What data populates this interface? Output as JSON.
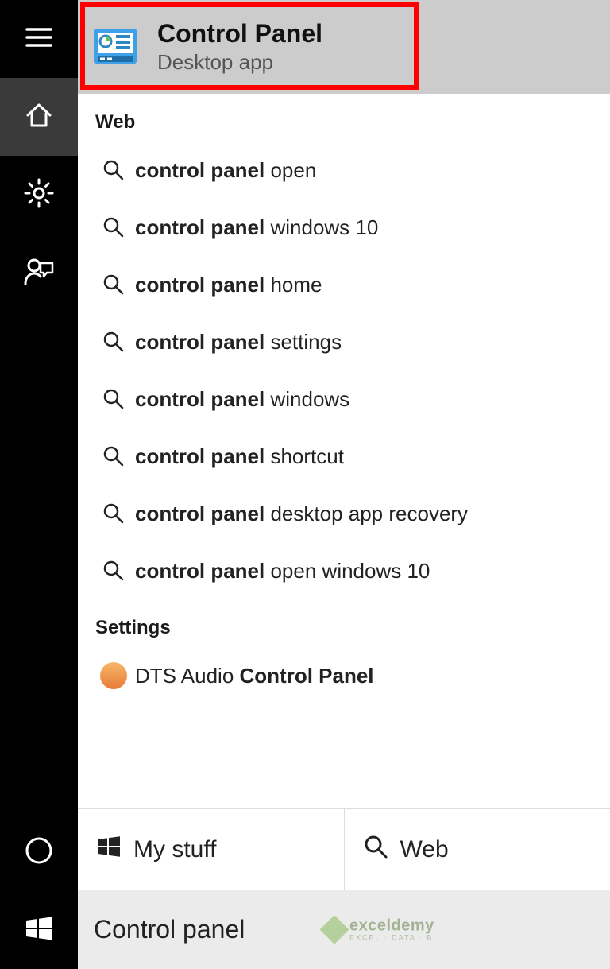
{
  "best_match": {
    "title": "Control Panel",
    "subtitle": "Desktop app"
  },
  "sections": {
    "web_label": "Web",
    "settings_label": "Settings"
  },
  "web_results": [
    {
      "bold": "control panel",
      "rest": " open"
    },
    {
      "bold": "control panel",
      "rest": " windows 10"
    },
    {
      "bold": "control panel",
      "rest": " home"
    },
    {
      "bold": "control panel",
      "rest": " settings"
    },
    {
      "bold": "control panel",
      "rest": " windows"
    },
    {
      "bold": "control panel",
      "rest": " shortcut"
    },
    {
      "bold": "control panel",
      "rest": " desktop app recovery"
    },
    {
      "bold": "control panel",
      "rest": " open windows 10"
    }
  ],
  "settings_results": [
    {
      "pre": "DTS Audio ",
      "bold": "Control Panel"
    }
  ],
  "footer": {
    "mystuff": "My stuff",
    "web": "Web"
  },
  "search": {
    "value": "Control panel"
  },
  "watermark": {
    "brand": "exceldemy",
    "tag": "EXCEL · DATA · BI"
  }
}
